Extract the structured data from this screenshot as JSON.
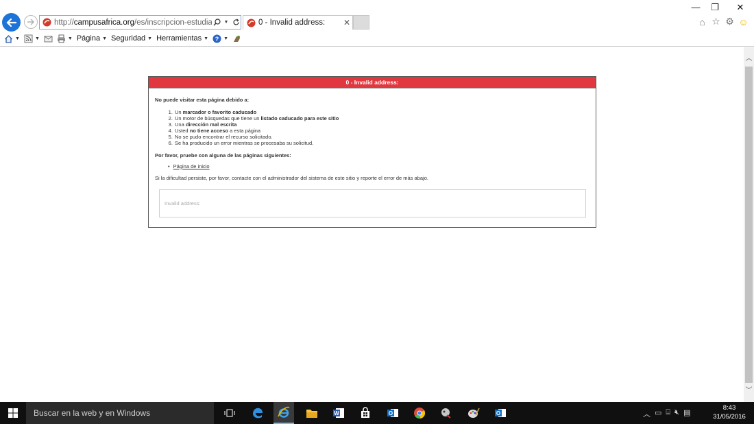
{
  "browser": {
    "url_prefix": "http://",
    "url_domain": "campusafrica.org",
    "url_path": "/es/inscripcion-estudiantes/vi",
    "tab_title": "0 - Invalid address:",
    "tab_close": "✕",
    "window_controls": {
      "minimize": "—",
      "restore": "❐",
      "close": "✕"
    }
  },
  "command_bar": {
    "page": "Página",
    "security": "Seguridad",
    "tools": "Herramientas"
  },
  "error": {
    "header": "0 - Invalid address:",
    "intro": "No puede visitar esta página debido a:",
    "reasons": [
      {
        "pre": "Un ",
        "bold": "marcador o favorito caducado",
        "post": ""
      },
      {
        "pre": "Un motor de búsquedas que tiene un ",
        "bold": "listado caducado para este sitio",
        "post": ""
      },
      {
        "pre": "Una ",
        "bold": "dirección mal escrita",
        "post": ""
      },
      {
        "pre": "Usted ",
        "bold": "no tiene acceso",
        "post": " a esta página"
      },
      {
        "pre": "No se pudo encontrar el recurso solicitado.",
        "bold": "",
        "post": ""
      },
      {
        "pre": "Se ha producido un error mientras se procesaba su solicitud.",
        "bold": "",
        "post": ""
      }
    ],
    "try_pages": "Por favor, pruebe con alguna de las páginas siguientes:",
    "home_link": "Página de inicio",
    "persist": "Si la dificultad persiste, por favor, contacte con el administrador del sistema de este sitio y reporte el error de más abajo.",
    "detail": "Invalid address:"
  },
  "taskbar": {
    "search_placeholder": "Buscar en la web y en Windows",
    "time": "8:43",
    "date": "31/05/2016"
  }
}
